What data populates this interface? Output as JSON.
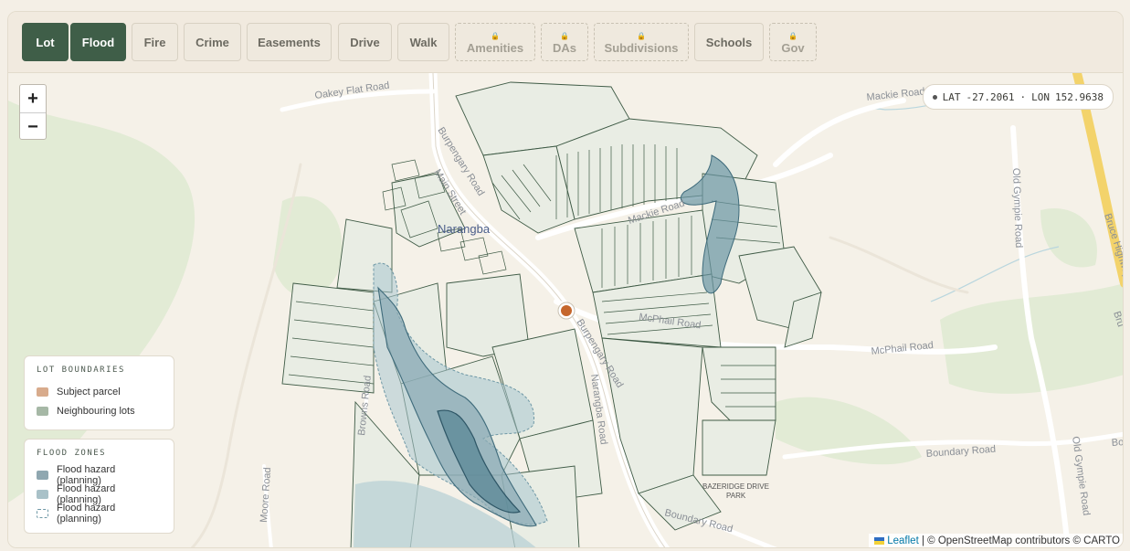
{
  "tabs": [
    {
      "label": "Lot",
      "active": true,
      "locked": false
    },
    {
      "label": "Flood",
      "active": true,
      "locked": false
    },
    {
      "label": "Fire",
      "active": false,
      "locked": false
    },
    {
      "label": "Crime",
      "active": false,
      "locked": false
    },
    {
      "label": "Easements",
      "active": false,
      "locked": false
    },
    {
      "label": "Drive",
      "active": false,
      "locked": false
    },
    {
      "label": "Walk",
      "active": false,
      "locked": false
    },
    {
      "label": "Amenities",
      "active": false,
      "locked": true
    },
    {
      "label": "DAs",
      "active": false,
      "locked": true
    },
    {
      "label": "Subdivisions",
      "active": false,
      "locked": true
    },
    {
      "label": "Schools",
      "active": false,
      "locked": false
    },
    {
      "label": "Gov",
      "active": false,
      "locked": true
    }
  ],
  "zoom": {
    "in": "+",
    "out": "−"
  },
  "coords": {
    "lat_label": "LAT",
    "lat": "-27.2061",
    "sep": "·",
    "lon_label": "LON",
    "lon": "152.9638"
  },
  "legend_lots": {
    "title": "LOT BOUNDARIES",
    "items": [
      {
        "label": "Subject parcel",
        "color": "#d8ab8c"
      },
      {
        "label": "Neighbouring lots",
        "color": "#a6b8a6"
      }
    ]
  },
  "legend_flood": {
    "title": "FLOOD ZONES",
    "items": [
      {
        "label": "Flood hazard (planning)",
        "color": "#8fa7b0"
      },
      {
        "label": "Flood hazard (planning)",
        "color": "#a9c1c8"
      },
      {
        "label": "Flood hazard (planning)",
        "color": "#ffffff"
      }
    ]
  },
  "attribution": {
    "leaflet": "Leaflet",
    "rest": "| © OpenStreetMap contributors © CARTO"
  },
  "map_labels": {
    "oakey_flat": "Oakey Flat Road",
    "mackie1": "Mackie Road",
    "mackie2": "Mackie Road",
    "burpengary1": "Burpengary Road",
    "burpengary2": "Burpengary Road",
    "main_st": "Main Street",
    "narangba": "Narangba",
    "mcphail1": "McPhail Road",
    "mcphail2": "McPhail Road",
    "narangba_rd": "Narangba Road",
    "old_gympie1": "Old Gympie Road",
    "old_gympie2": "Old Gympie Road",
    "bruce": "Bruce Highway",
    "boundary1": "Boundary Road",
    "boundary2": "Boundary Road",
    "browns": "Browns Road",
    "moore": "Moore Road",
    "bazeridge1": "BAZERIDGE DRIVE",
    "bazeridge2": "PARK",
    "edge_bru": "Bru",
    "edge_bo": "Bo"
  }
}
